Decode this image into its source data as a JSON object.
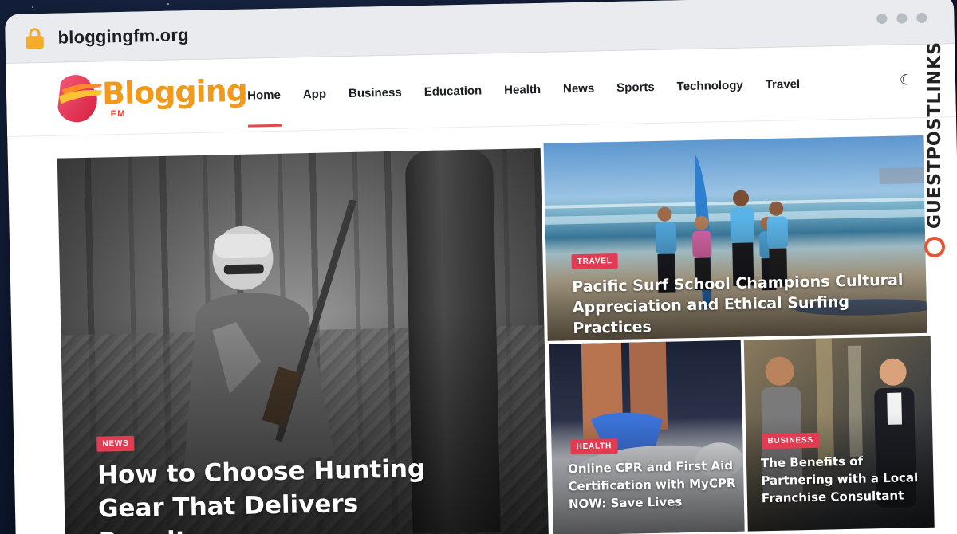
{
  "browser": {
    "url": "bloggingfm.org"
  },
  "site": {
    "logo_text": "Blogging",
    "logo_sub": "FM",
    "nav": [
      {
        "label": "Home",
        "active": true
      },
      {
        "label": "App"
      },
      {
        "label": "Business"
      },
      {
        "label": "Education"
      },
      {
        "label": "Health"
      },
      {
        "label": "News"
      },
      {
        "label": "Sports"
      },
      {
        "label": "Technology"
      },
      {
        "label": "Travel"
      }
    ],
    "theme_toggle_icon": "moon-icon"
  },
  "posts": [
    {
      "category": "NEWS",
      "title": "How to Choose Hunting Gear That Delivers Results"
    },
    {
      "category": "TRAVEL",
      "title": "Pacific Surf School Champions Cultural Appreciation and Ethical Surfing Practices"
    },
    {
      "category": "HEALTH",
      "title": "Online CPR and First Aid Certification with MyCPR NOW: Save Lives"
    },
    {
      "category": "BUSINESS",
      "title": "The Benefits of Partnering with a Local Franchise Consultant"
    }
  ],
  "watermark": {
    "text": "GUESTPOSTLINKS"
  },
  "colors": {
    "accent": "#e23b52",
    "logo_orange": "#f19a1a",
    "logo_red": "#e9412b",
    "watermark_orange": "#e8542f"
  }
}
